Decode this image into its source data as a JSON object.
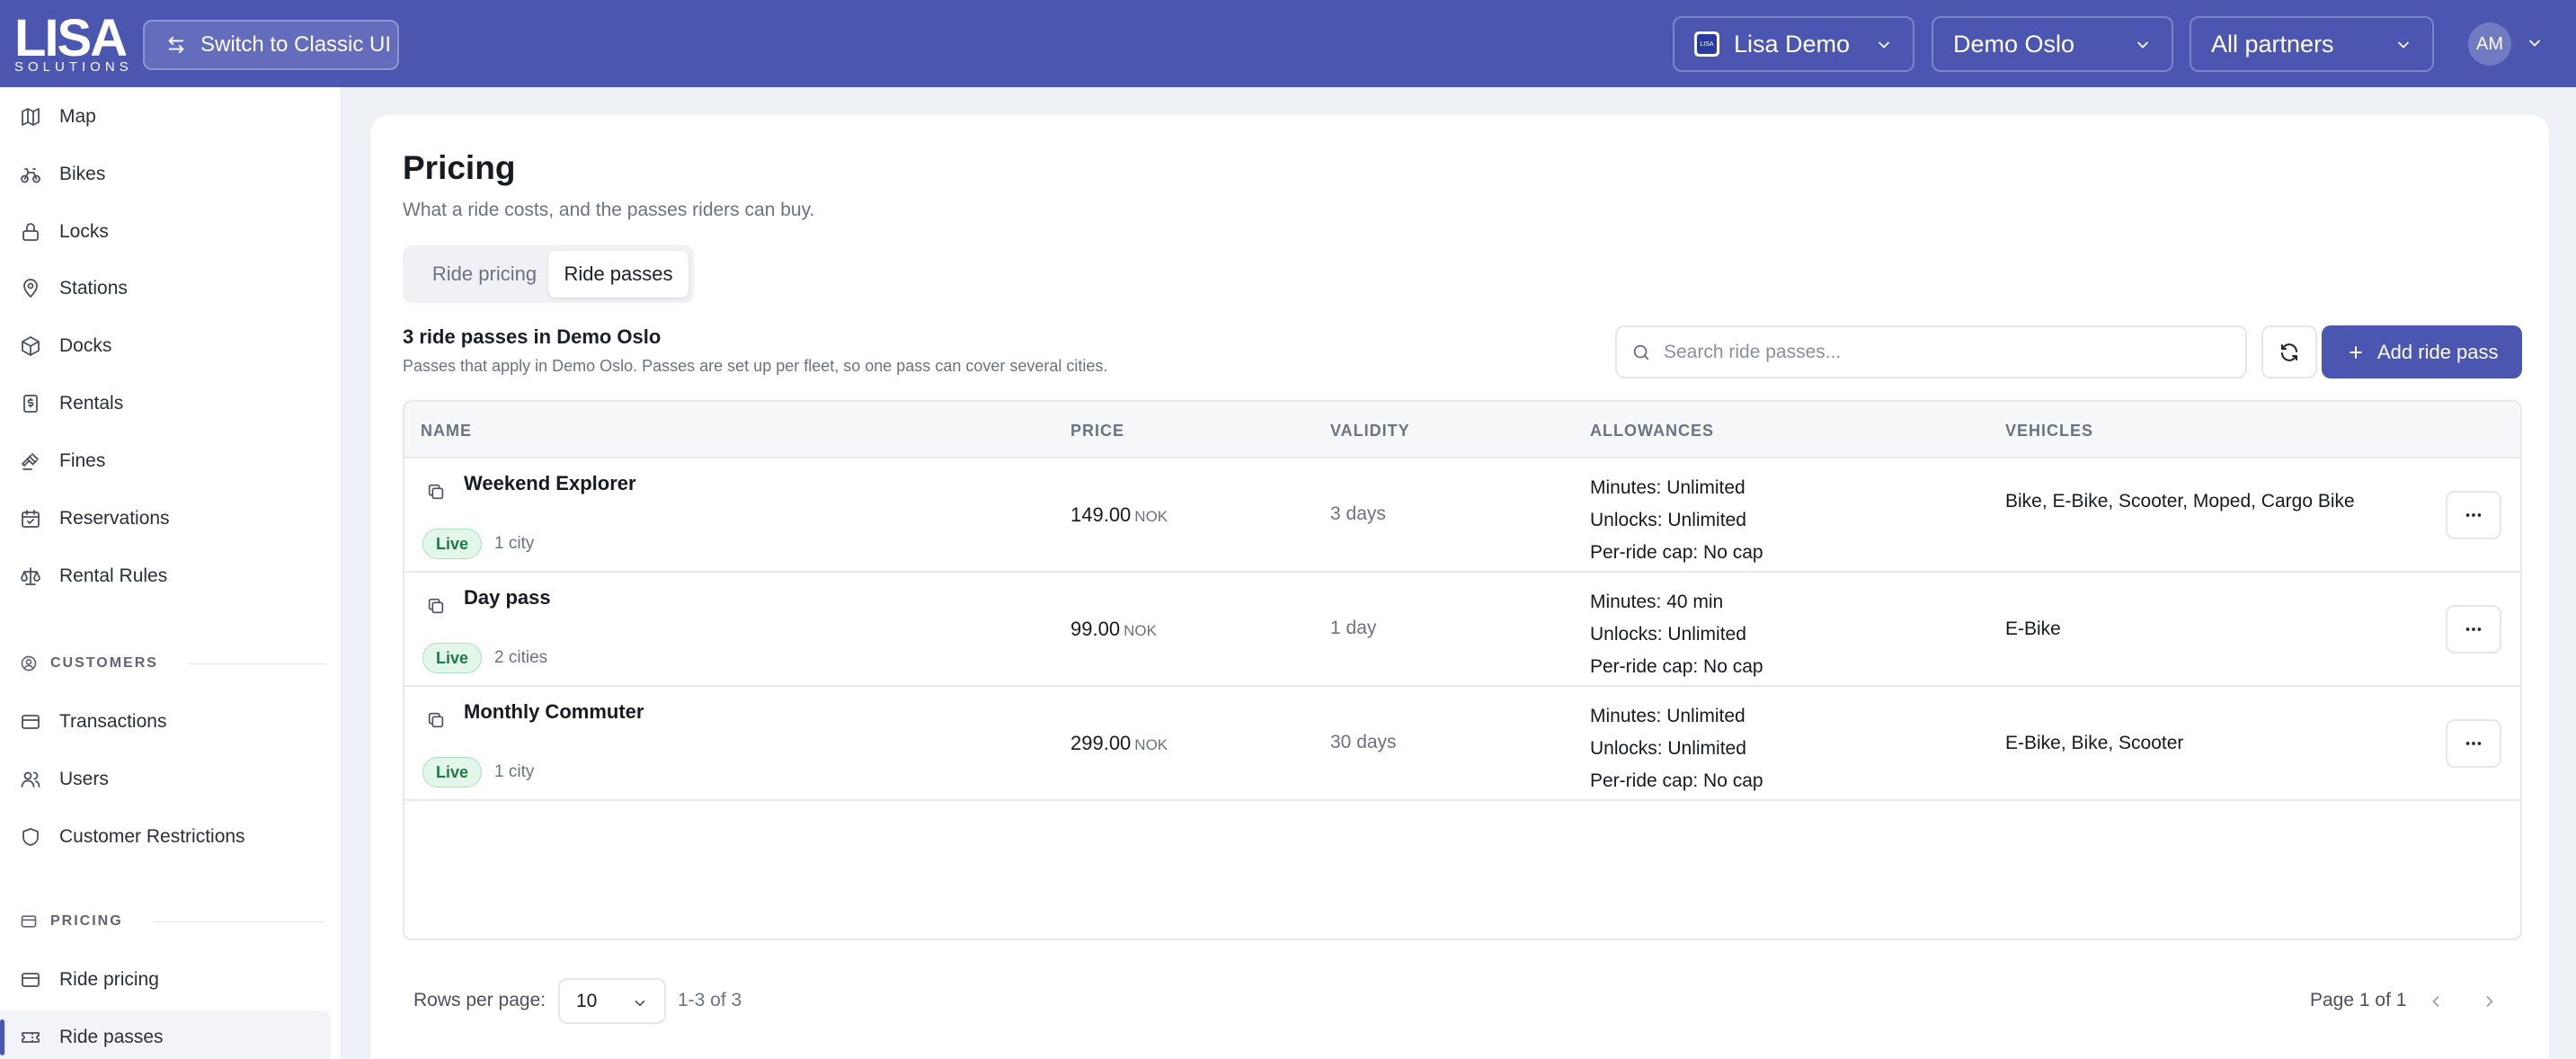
{
  "brand": {
    "logo_text": "LISA",
    "logo_sub": "SOLUTIONS"
  },
  "header": {
    "classic_label": "Switch to Classic UI",
    "org_icon_text": "LISA",
    "org": "Lisa Demo",
    "city": "Demo Oslo",
    "partners": "All partners",
    "avatar": "AM"
  },
  "sidebar": {
    "items": [
      {
        "label": "Map",
        "icon": "map-icon"
      },
      {
        "label": "Bikes",
        "icon": "bike-icon"
      },
      {
        "label": "Locks",
        "icon": "lock-icon"
      },
      {
        "label": "Stations",
        "icon": "map-pin-icon"
      },
      {
        "label": "Docks",
        "icon": "box-icon"
      },
      {
        "label": "Rentals",
        "icon": "receipt-icon"
      },
      {
        "label": "Fines",
        "icon": "gavel-icon"
      },
      {
        "label": "Reservations",
        "icon": "calendar-icon"
      },
      {
        "label": "Rental Rules",
        "icon": "scale-icon"
      }
    ],
    "customers_header": "CUSTOMERS",
    "customer_items": [
      {
        "label": "Transactions",
        "icon": "credit-card-icon"
      },
      {
        "label": "Users",
        "icon": "users-icon"
      },
      {
        "label": "Customer Restrictions",
        "icon": "shield-icon"
      }
    ],
    "pricing_header": "PRICING",
    "pricing_items": [
      {
        "label": "Ride pricing",
        "icon": "credit-card-icon"
      },
      {
        "label": "Ride passes",
        "icon": "ticket-icon"
      }
    ]
  },
  "page": {
    "title": "Pricing",
    "subtitle": "What a ride costs, and the passes riders can buy.",
    "tabs": [
      {
        "label": "Ride pricing"
      },
      {
        "label": "Ride passes"
      }
    ],
    "active_tab": "Ride passes",
    "count_title": "3 ride passes in Demo Oslo",
    "count_sub": "Passes that apply in Demo Oslo. Passes are set up per fleet, so one pass can cover several cities.",
    "search_placeholder": "Search ride passes...",
    "add_label": "Add ride pass"
  },
  "table": {
    "columns": [
      "NAME",
      "PRICE",
      "VALIDITY",
      "ALLOWANCES",
      "VEHICLES"
    ],
    "rows": [
      {
        "name": "Weekend Explorer",
        "status": "Live",
        "cities": "1 city",
        "price": "149.00",
        "currency": "NOK",
        "validity": "3 days",
        "minutes": "Minutes: Unlimited",
        "unlocks": "Unlocks: Unlimited",
        "cap": "Per-ride cap: No cap",
        "vehicles": "Bike, E-Bike, Scooter, Moped, Cargo Bike"
      },
      {
        "name": "Day pass",
        "status": "Live",
        "cities": "2 cities",
        "price": "99.00",
        "currency": "NOK",
        "validity": "1 day",
        "minutes": "Minutes: 40 min",
        "unlocks": "Unlocks: Unlimited",
        "cap": "Per-ride cap: No cap",
        "vehicles": "E-Bike"
      },
      {
        "name": "Monthly Commuter",
        "status": "Live",
        "cities": "1 city",
        "price": "299.00",
        "currency": "NOK",
        "validity": "30 days",
        "minutes": "Minutes: Unlimited",
        "unlocks": "Unlocks: Unlimited",
        "cap": "Per-ride cap: No cap",
        "vehicles": "E-Bike, Bike, Scooter"
      }
    ]
  },
  "footer": {
    "rows_label": "Rows per page:",
    "rows_value": "10",
    "range": "1-3 of 3",
    "page_info": "Page 1 of 1"
  },
  "colors": {
    "accent": "#4a56b0",
    "live_bg": "#e3f6ea",
    "live_text": "#1f7a45"
  }
}
